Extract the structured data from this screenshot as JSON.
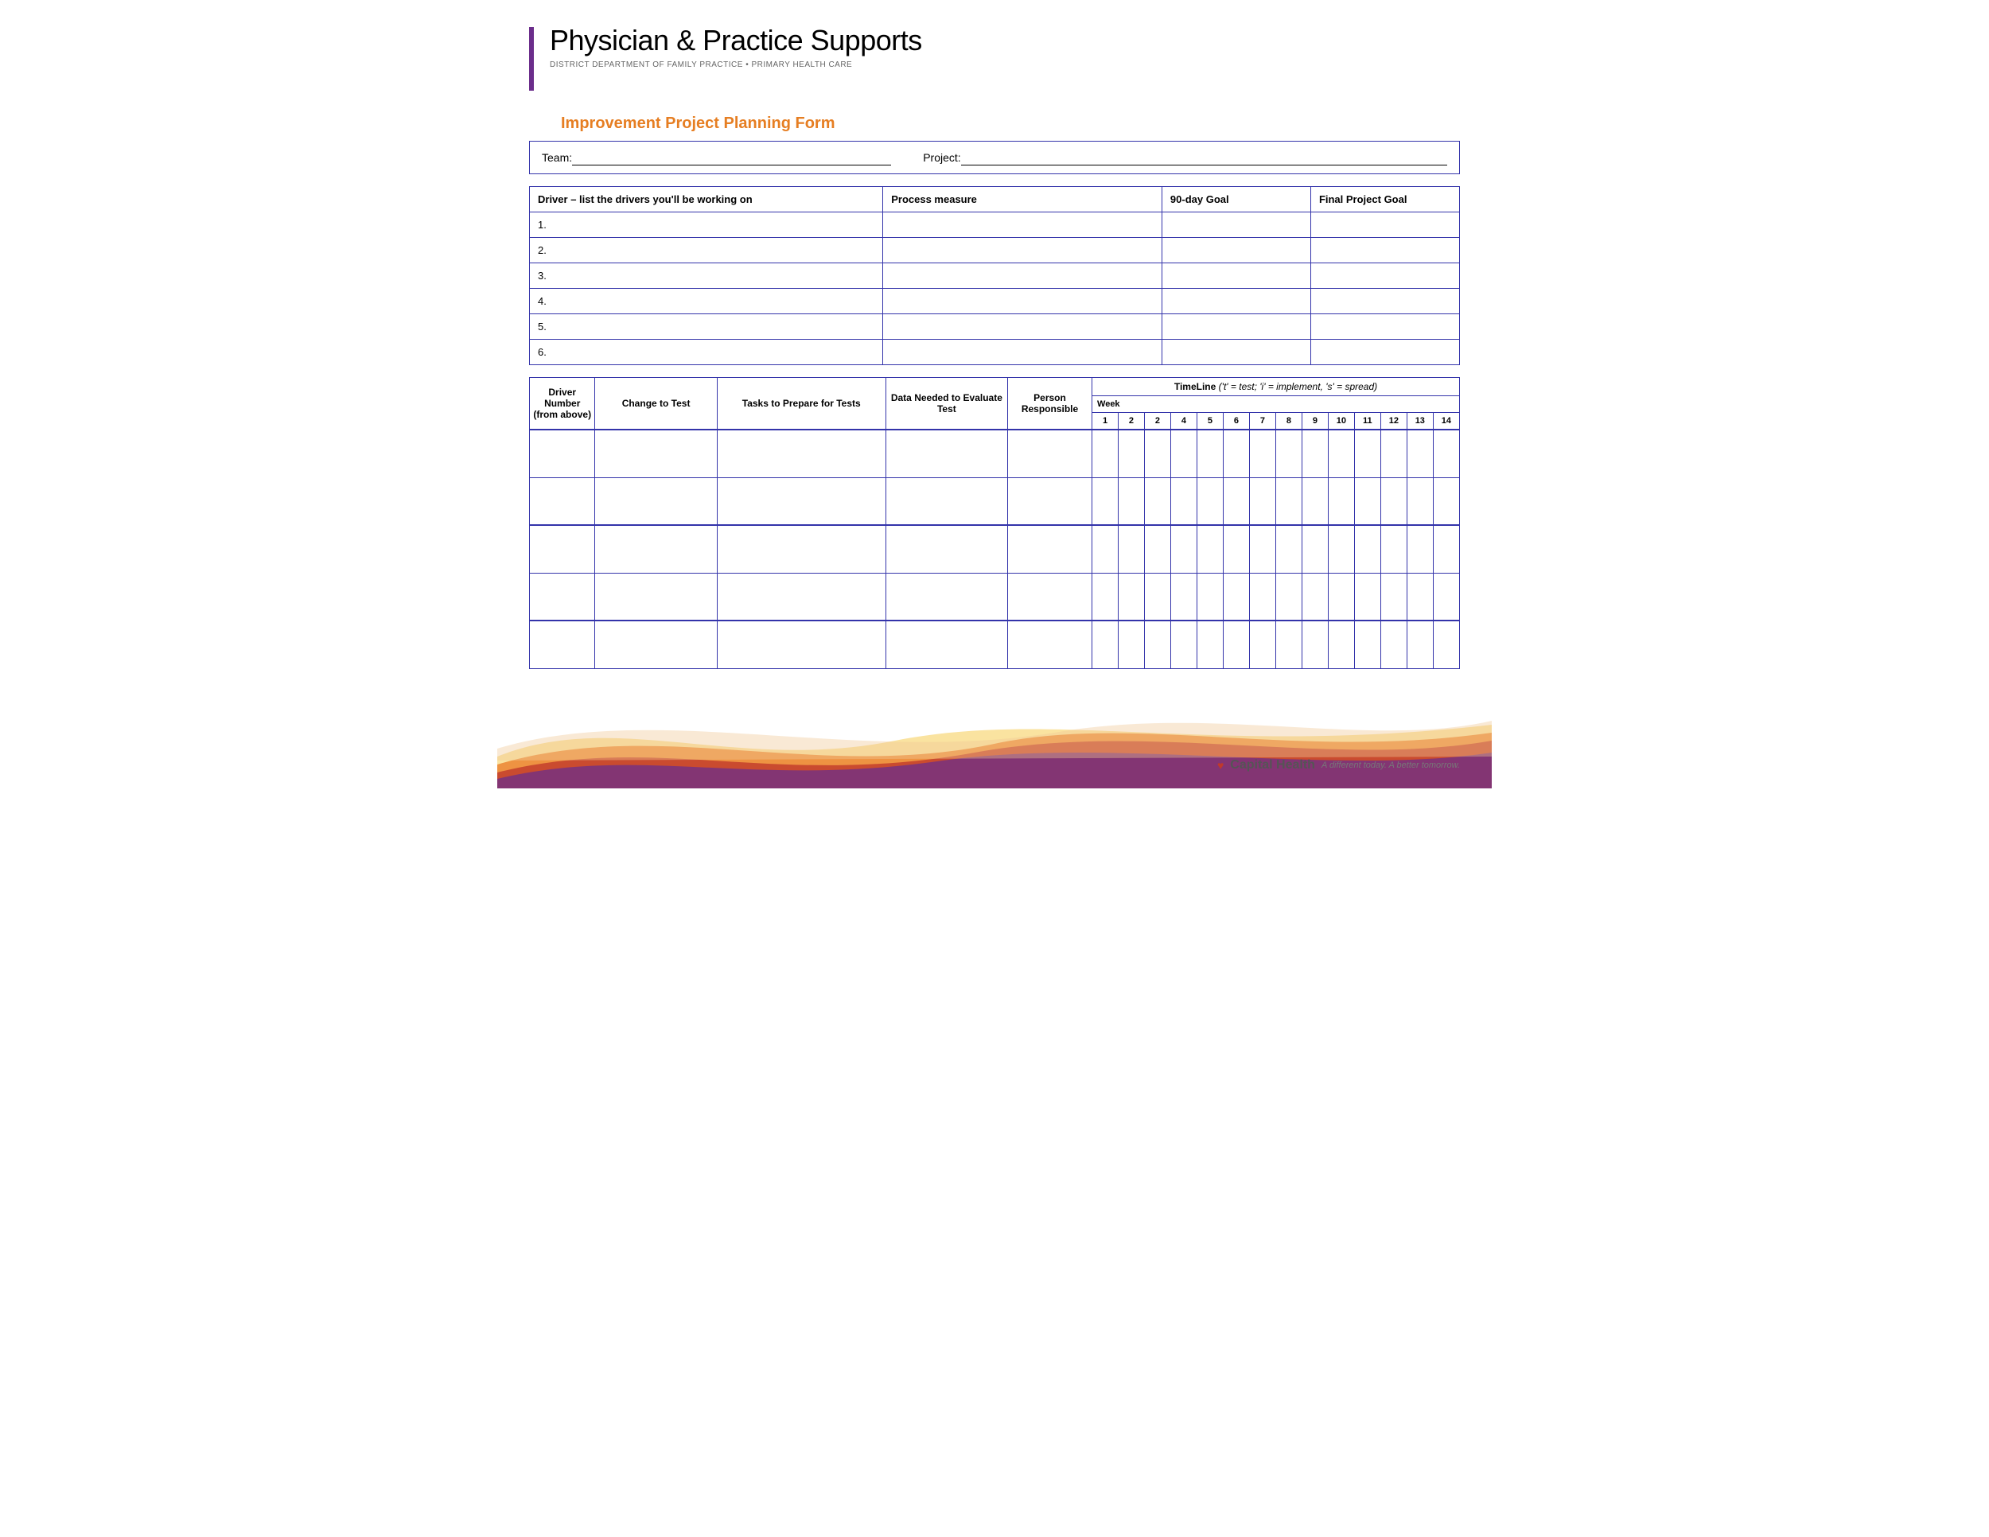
{
  "header": {
    "bar_color": "#6b2d8b",
    "title": "Physician & Practice Supports",
    "subtitle": "DISTRICT DEPARTMENT OF FAMILY PRACTICE  •  PRIMARY HEALTH CARE"
  },
  "form": {
    "title": "Improvement Project Planning Form",
    "team_label": "Team:",
    "project_label": "Project:"
  },
  "driver_table": {
    "columns": [
      "Driver – list the drivers you'll be working on",
      "Process measure",
      "90-day Goal",
      "Final Project Goal"
    ],
    "rows": [
      "1.",
      "2.",
      "3.",
      "4.",
      "5.",
      "6."
    ]
  },
  "timeline_table": {
    "header_label": "TimeLine",
    "header_legend": "('t' = test; 'i' = implement, 's' = spread)",
    "columns": {
      "driver_number": "Driver Number (from above)",
      "change_to_test": "Change to Test",
      "tasks": "Tasks to Prepare for Tests",
      "data_needed": "Data Needed to Evaluate Test",
      "person_responsible": "Person Responsible"
    },
    "week_label": "Week",
    "week_numbers": [
      "1",
      "2",
      "2",
      "4",
      "5",
      "6",
      "7",
      "8",
      "9",
      "10",
      "11",
      "12",
      "13",
      "14"
    ],
    "data_rows": 5
  },
  "footer": {
    "capital_health_label": "Capital Health",
    "tagline": "A different today. A better tomorrow.",
    "wave_colors": {
      "orange_light": "#f5a623",
      "orange": "#e8701a",
      "red": "#c0392b",
      "purple": "#6b2d8b",
      "gold": "#d4a017"
    }
  }
}
